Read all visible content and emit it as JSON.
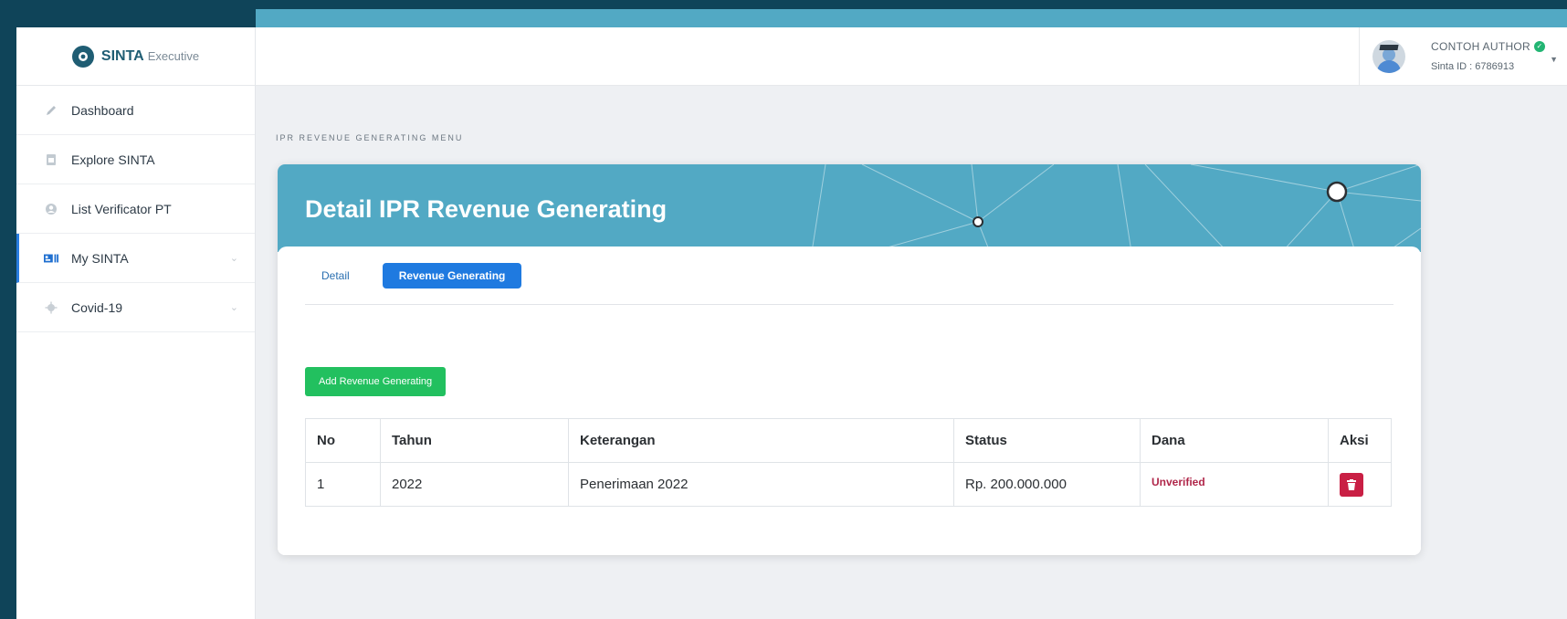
{
  "app": {
    "brand": "SINTA",
    "brand_sub": "Executive"
  },
  "sidebar": {
    "items": [
      {
        "label": "Dashboard",
        "icon": "pencil-icon"
      },
      {
        "label": "Explore SINTA",
        "icon": "document-icon"
      },
      {
        "label": "List Verificator PT",
        "icon": "user-circle-icon"
      },
      {
        "label": "My SINTA",
        "icon": "id-card-icon",
        "active": true
      },
      {
        "label": "Covid-19",
        "icon": "virus-icon"
      }
    ]
  },
  "header": {
    "user_name": "CONTOH AUTHOR",
    "user_id": "Sinta ID : 6786913"
  },
  "page": {
    "section_label": "IPR REVENUE GENERATING MENU",
    "title": "Detail IPR Revenue Generating",
    "tabs": [
      {
        "label": "Detail",
        "active": false
      },
      {
        "label": "Revenue Generating",
        "active": true
      }
    ],
    "add_button": "Add Revenue Generating"
  },
  "table": {
    "headers": [
      "No",
      "Tahun",
      "Keterangan",
      "Status",
      "Dana",
      "Aksi"
    ],
    "rows": [
      {
        "no": "1",
        "tahun": "2022",
        "keterangan": "Penerimaan 2022",
        "status": "Rp. 200.000.000",
        "dana": "Unverified"
      }
    ]
  },
  "colors": {
    "banner": "#52a9c4",
    "active_tab": "#1f7ae0",
    "add_button": "#22c05f",
    "delete_button": "#c91f44",
    "unverified_text": "#b0274a"
  }
}
